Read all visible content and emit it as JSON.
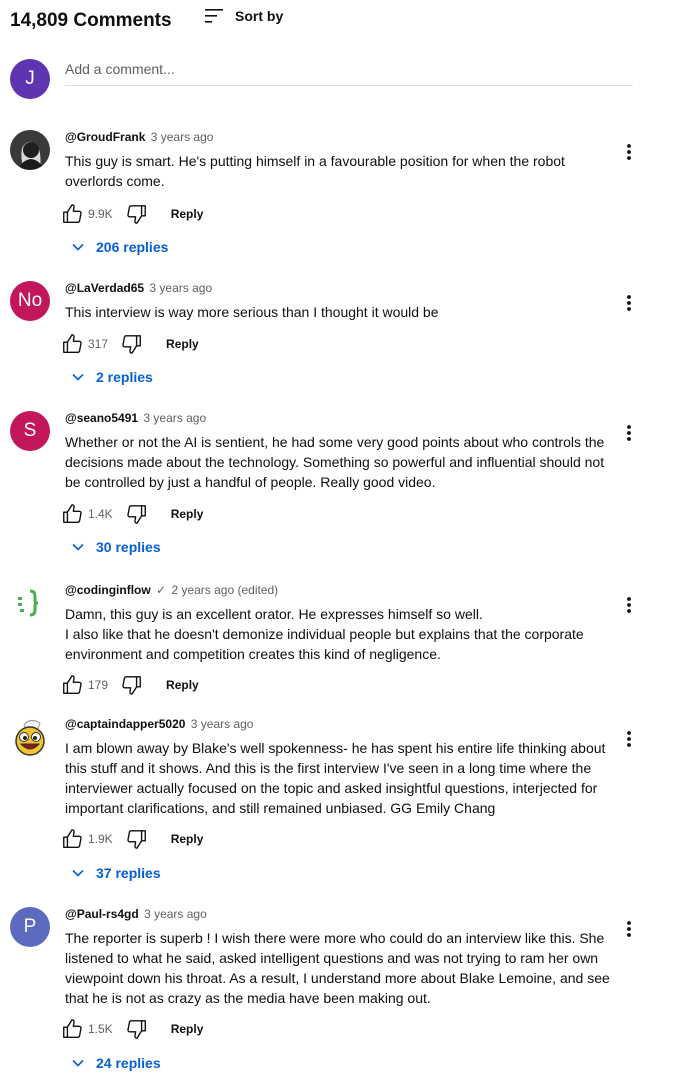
{
  "header": {
    "count": "14,809 Comments",
    "sort_label": "Sort by"
  },
  "add_comment": {
    "avatar_letter": "J",
    "placeholder": "Add a comment...",
    "avatar_color": "#5e35b1"
  },
  "comments": [
    {
      "author": "@GroudFrank",
      "time": "3 years ago",
      "text": "This guy is smart. He's putting himself in a favourable position for when the robot overlords come.",
      "likes": "9.9K",
      "reply": "Reply",
      "replies": "206 replies",
      "avatar": "photo"
    },
    {
      "author": "@LaVerdad65",
      "time": "3 years ago",
      "text": "This interview is way more serious than I thought it would be",
      "likes": "317",
      "reply": "Reply",
      "replies": "2 replies",
      "avatar_letter": "No",
      "avatar_color": "#c2185b"
    },
    {
      "author": "@seano5491",
      "time": "3 years ago",
      "text": "Whether or not the AI is sentient, he had some very good points about who controls the decisions made about the technology. Something so powerful and influential should not be controlled by just a handful of people. Really good video.",
      "likes": "1.4K",
      "reply": "Reply",
      "replies": "30 replies",
      "avatar_letter": "S",
      "avatar_color": "#c2185b"
    },
    {
      "author": "@codinginflow",
      "time": "2 years ago (edited)",
      "text": "Damn, this guy is an excellent orator. He expresses himself so well.\nI also like that he doesn't demonize individual people but explains that the corporate environment and competition creates this kind of negligence.",
      "likes": "179",
      "reply": "Reply",
      "avatar": "code-logo"
    },
    {
      "author": "@captaindapper5020",
      "time": "3 years ago",
      "text": "I am blown away by Blake's well spokenness- he has spent his entire life thinking about this stuff and it shows. And this is the first interview I've seen in a long time where the interviewer actually focused on the topic and asked insightful questions, interjected for important clarifications, and still remained unbiased. GG Emily Chang",
      "likes": "1.9K",
      "reply": "Reply",
      "replies": "37 replies",
      "avatar": "smiley-captain"
    },
    {
      "author": "@Paul-rs4gd",
      "time": "3 years ago",
      "text": "The reporter is superb ! I wish there were more who could do an interview like this.  She listened to what he said, asked intelligent questions and was not trying to ram her own viewpoint down his throat.  As a result, I understand more about Blake Lemoine, and see that he is not as crazy as the media have been making out.",
      "likes": "1.5K",
      "reply": "Reply",
      "replies": "24 replies",
      "avatar_letter": "P",
      "avatar_color": "#5c6bc0"
    }
  ]
}
